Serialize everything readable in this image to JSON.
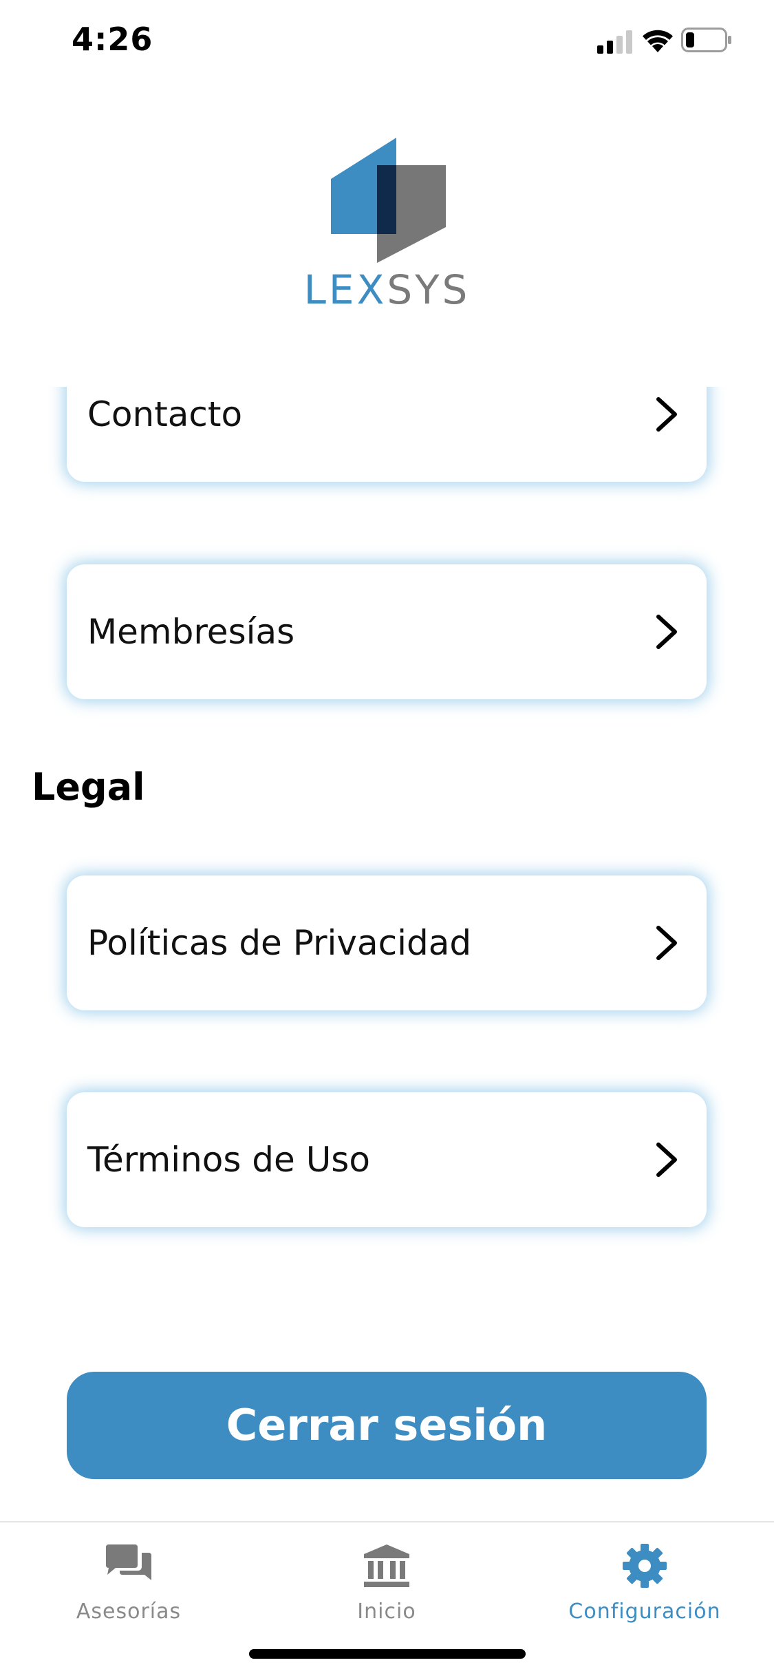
{
  "status_bar": {
    "time": "4:26"
  },
  "logo": {
    "word_part1": "LEX",
    "word_part2": "SYS"
  },
  "menu": {
    "items": [
      {
        "label": "Contacto"
      },
      {
        "label": "Membresías"
      }
    ],
    "legal_title": "Legal",
    "legal_items": [
      {
        "label": "Políticas de Privacidad"
      },
      {
        "label": "Términos de Uso"
      }
    ]
  },
  "logout": {
    "label": "Cerrar sesión"
  },
  "tab_bar": {
    "tabs": [
      {
        "label": "Asesorías",
        "icon": "chat-bubbles-icon",
        "active": false
      },
      {
        "label": "Inicio",
        "icon": "bank-building-icon",
        "active": false
      },
      {
        "label": "Configuración",
        "icon": "gear-icon",
        "active": true
      }
    ]
  },
  "colors": {
    "accent": "#3e8dc2",
    "inactive": "#8a8a8a",
    "card_glow": "#3ea0d7"
  }
}
